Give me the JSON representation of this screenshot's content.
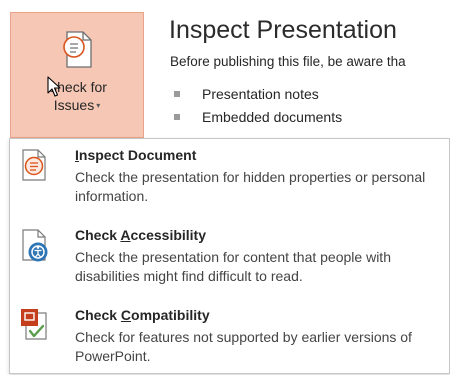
{
  "check_button": {
    "line1": "Check for",
    "line2": "Issues",
    "caret": "▾"
  },
  "inspect_panel": {
    "title": "Inspect Presentation",
    "description": "Before publishing this file, be aware tha",
    "bullets": [
      "Presentation notes",
      "Embedded documents"
    ]
  },
  "menu": {
    "items": [
      {
        "icon": "inspect-document-icon",
        "title_before": "",
        "title_underline": "I",
        "title_after": "nspect Document",
        "description": "Check the presentation for hidden properties or personal information."
      },
      {
        "icon": "accessibility-check-icon",
        "title_before": "Check ",
        "title_underline": "A",
        "title_after": "ccessibility",
        "description": "Check the presentation for content that people with disabilities might find difficult to read."
      },
      {
        "icon": "compatibility-check-icon",
        "title_before": "Check ",
        "title_underline": "C",
        "title_after": "ompatibility",
        "description": "Check for features not supported by earlier versions of PowerPoint."
      }
    ]
  },
  "colors": {
    "button_bg": "#f6c7b4",
    "accent_blue": "#2e75b6",
    "accent_red": "#c43e1c",
    "check_green": "#5a9e4b"
  }
}
